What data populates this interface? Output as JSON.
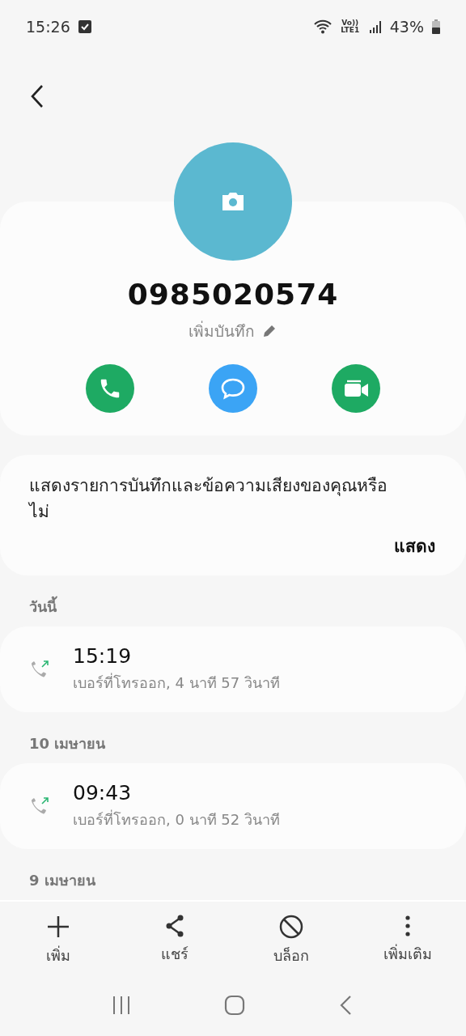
{
  "status_bar": {
    "time": "15:26",
    "network": "Vo)) LTE1",
    "battery": "43%"
  },
  "contact": {
    "number": "0985020574",
    "note_label": "เพิ่มบันทึก"
  },
  "actions": [
    {
      "kind": "call"
    },
    {
      "kind": "message"
    },
    {
      "kind": "video"
    }
  ],
  "prompt": {
    "text": "แสดงรายการบันทึกและข้อความเสียงของคุณหรือไม่",
    "button": "แสดง"
  },
  "call_groups": [
    {
      "date": "วันนี้",
      "calls": [
        {
          "time": "15:19",
          "detail": "เบอร์ที่โทรออก, 4 นาที 57 วินาที"
        }
      ]
    },
    {
      "date": "10 เมษายน",
      "calls": [
        {
          "time": "09:43",
          "detail": "เบอร์ที่โทรออก, 0 นาที 52 วินาที"
        }
      ]
    },
    {
      "date": "9 เมษายน"
    }
  ],
  "bottom_actions": [
    {
      "kind": "add",
      "label": "เพิ่ม"
    },
    {
      "kind": "share",
      "label": "แชร์"
    },
    {
      "kind": "block",
      "label": "บล็อก"
    },
    {
      "kind": "more",
      "label": "เพิ่มเติม"
    }
  ]
}
